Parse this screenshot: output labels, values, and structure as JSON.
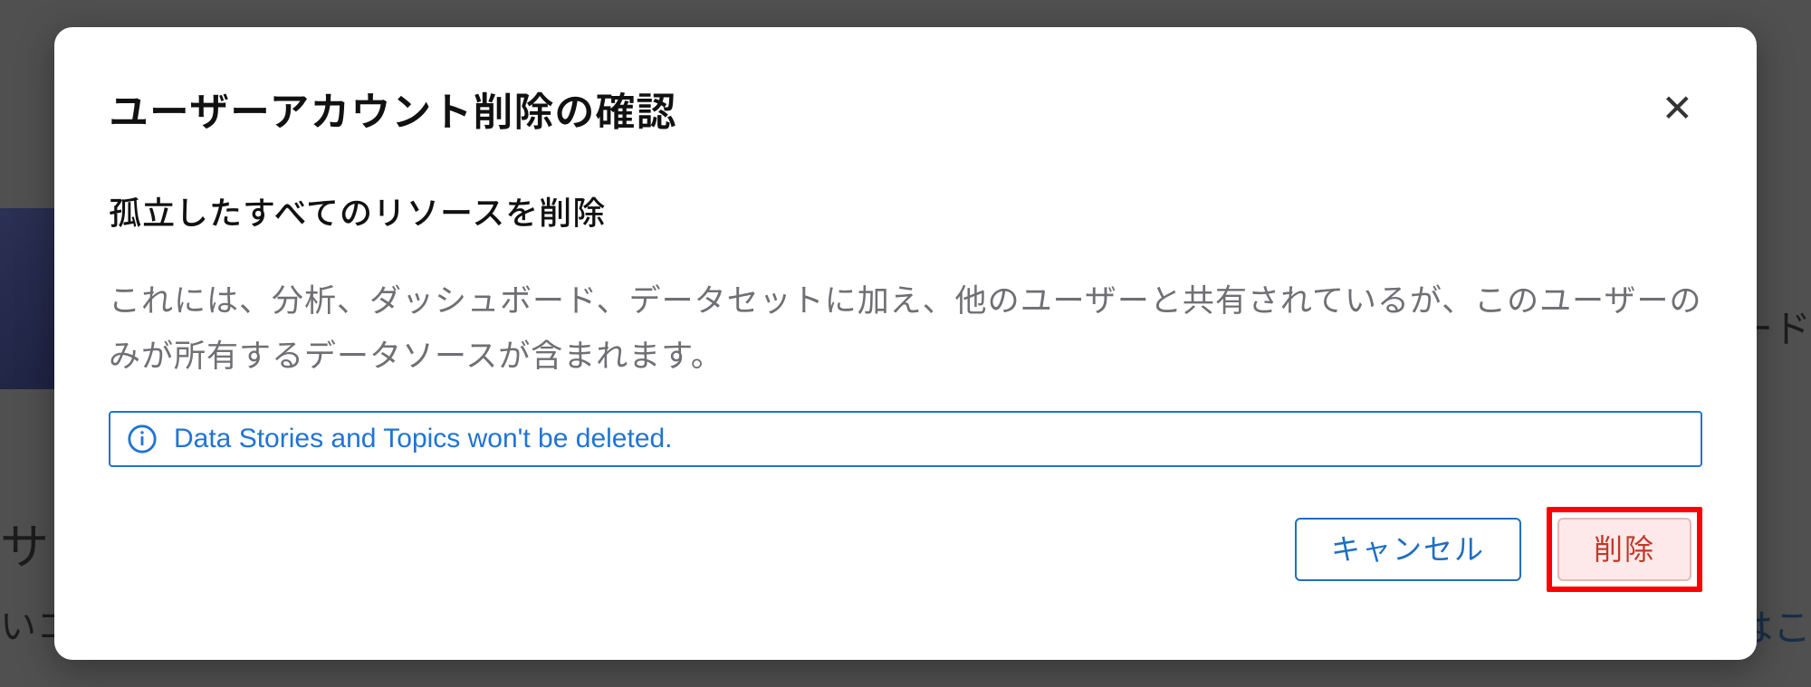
{
  "modal": {
    "title": "ユーザーアカウント削除の確認",
    "close_label": "✕",
    "section_title": "孤立したすべてのリソースを削除",
    "description": "これには、分析、ダッシュボード、データセットに加え、他のユーザーと共有されているが、このユーザーのみが所有するデータソースが含まれます。",
    "info_text": "Data Stories and Topics won't be deleted.",
    "cancel_label": "キャンセル",
    "delete_label": "削除"
  },
  "background": {
    "text_left_1": "サ",
    "text_left_2": "いコ",
    "text_right_1": "ード",
    "text_right_2": "細はこ"
  }
}
